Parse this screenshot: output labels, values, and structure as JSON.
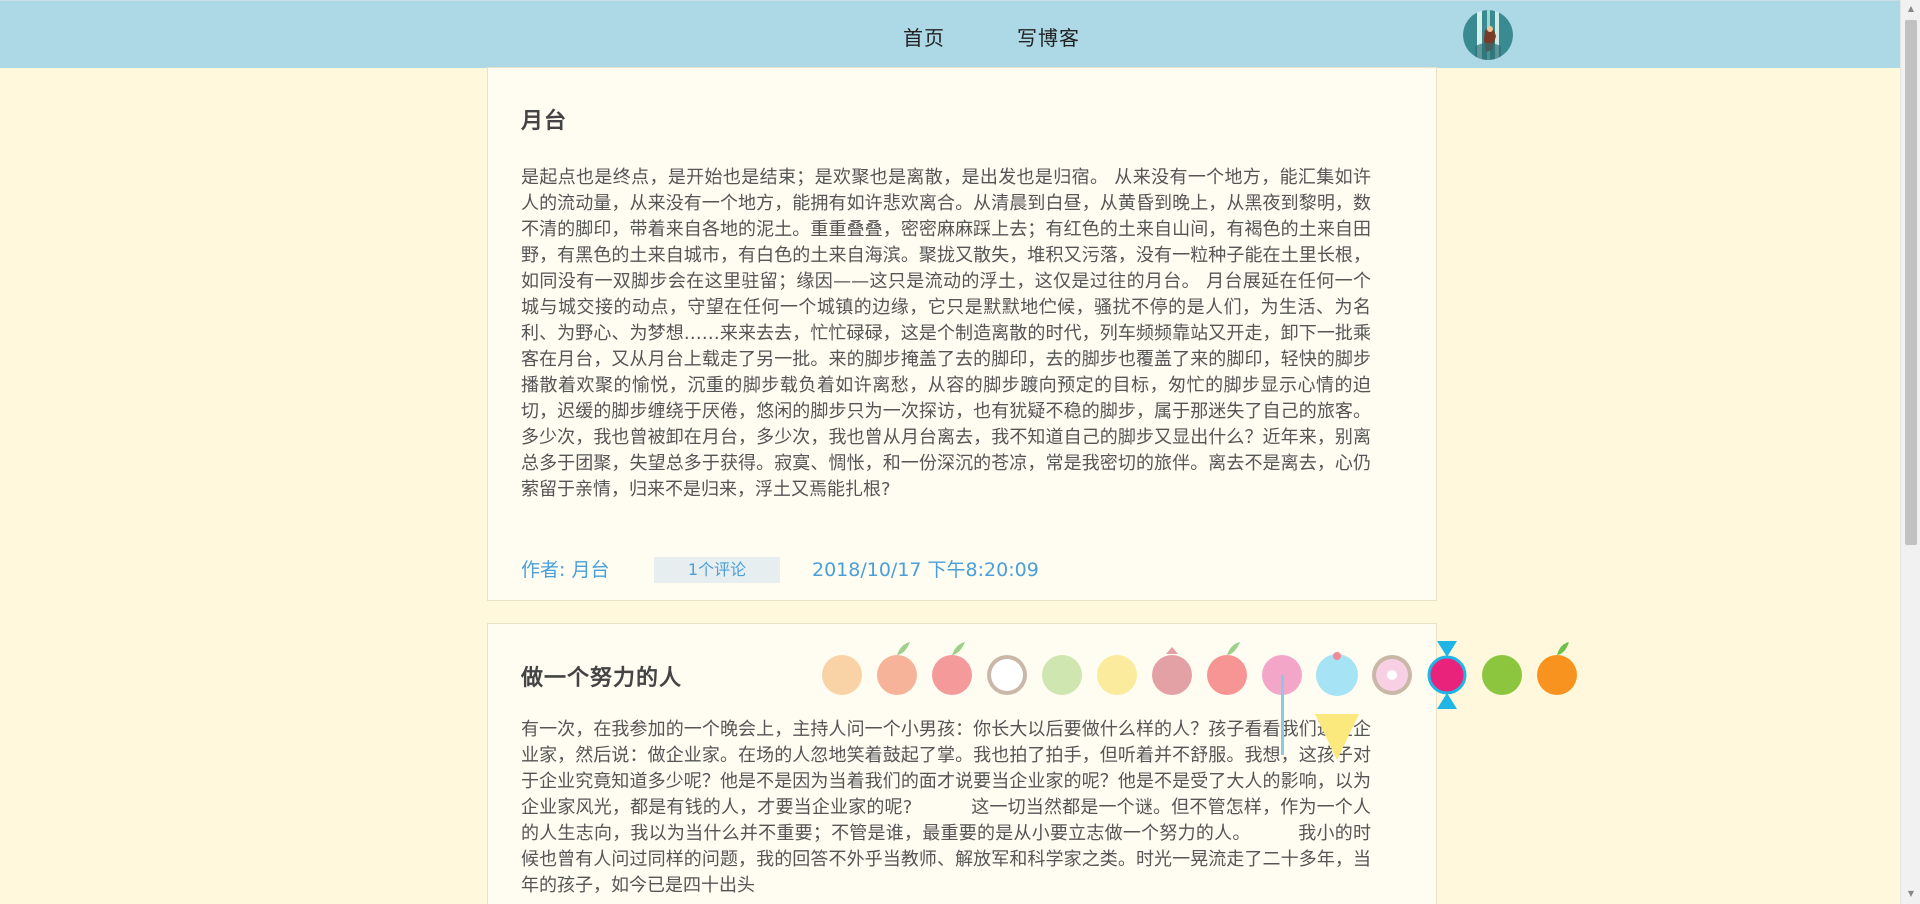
{
  "nav": {
    "home_label": "首页",
    "write_label": "写博客"
  },
  "posts": [
    {
      "title": "月台",
      "body": "是起点也是终点，是开始也是结束；是欢聚也是离散，是出发也是归宿。 从来没有一个地方，能汇集如许人的流动量，从来没有一个地方，能拥有如许悲欢离合。从清晨到白昼，从黄昏到晚上，从黑夜到黎明，数不清的脚印，带着来自各地的泥土。重重叠叠，密密麻麻踩上去；有红色的土来自山间，有褐色的土来自田野，有黑色的土来自城市，有白色的土来自海滨。聚拢又散失，堆积又污落，没有一粒种子能在土里长根，如同没有一双脚步会在这里驻留；缘因——这只是流动的浮土，这仅是过往的月台。 月台展延在任何一个城与城交接的动点，守望在任何一个城镇的边缘，它只是默默地伫候，骚扰不停的是人们，为生活、为名利、为野心、为梦想……来来去去，忙忙碌碌，这是个制造离散的时代，列车频频靠站又开走，卸下一批乘客在月台，又从月台上载走了另一批。来的脚步掩盖了去的脚印，去的脚步也覆盖了来的脚印，轻快的脚步播散着欢聚的愉悦，沉重的脚步载负着如许离愁，从容的脚步踱向预定的目标，匆忙的脚步显示心情的迫切，迟缓的脚步缠绕于厌倦，悠闲的脚步只为一次探访，也有犹疑不稳的脚步，属于那迷失了自己的旅客。 多少次，我也曾被卸在月台，多少次，我也曾从月台离去，我不知道自己的脚步又显出什么？近年来，别离总多于团聚，失望总多于获得。寂寞、惆怅，和一份深沉的苍凉，常是我密切的旅伴。离去不是离去，心仍萦留于亲情，归来不是归来，浮土又焉能扎根?",
      "author": "作者: 月台",
      "comments": "1个评论",
      "date": "2018/10/17 下午8:20:09"
    },
    {
      "title": "做一个努力的人",
      "body": "有一次，在我参加的一个晚会上，主持人问一个小男孩：你长大以后要做什么样的人？孩子看看我们这些企业家，然后说：做企业家。在场的人忽地笑着鼓起了掌。我也拍了拍手，但听着并不舒服。我想，这孩子对于企业究竟知道多少呢？他是不是因为当着我们的面才说要当企业家的呢？他是不是受了大人的影响，以为企业家风光，都是有钱的人，才要当企业家的呢?          这一切当然都是一个谜。但不管怎样，作为一个人的人生志向，我以为当什么并不重要；不管是谁，最重要的是从小要立志做一个努力的人。        我小的时候也曾有人问过同样的问题，我的回答不外乎当教师、解放军和科学家之类。时光一晃流走了二十多年，当年的孩子，如今已是四十出头"
    }
  ],
  "colors": {
    "header_bg": "#add8e6",
    "page_bg": "#fff8dc",
    "link": "#4a9fd8"
  },
  "decorations": [
    "peach",
    "apple",
    "apple",
    "donut",
    "melon",
    "lemon",
    "pomegranate",
    "apple",
    "plum",
    "ice-cream",
    "donut",
    "candy",
    "lime",
    "orange"
  ]
}
